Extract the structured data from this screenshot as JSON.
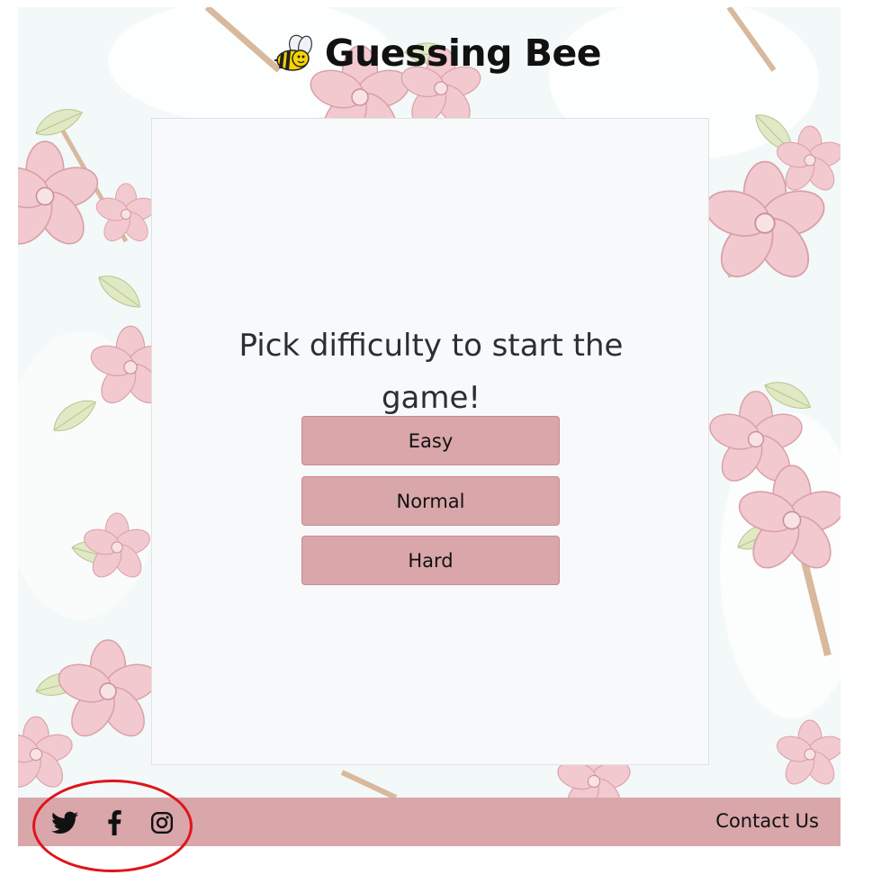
{
  "header": {
    "title": "Guessing Bee",
    "logo_icon": "bee-icon"
  },
  "game": {
    "prompt": "Pick difficulty to start the game!",
    "buttons": {
      "easy": "Easy",
      "normal": "Normal",
      "hard": "Hard"
    }
  },
  "footer": {
    "social_icons": [
      "twitter-icon",
      "facebook-icon",
      "instagram-icon"
    ],
    "contact_label": "Contact Us"
  },
  "colors": {
    "accent": "#d9a6aa",
    "card_background": "#f8f9fa",
    "annotation": "#e0131a"
  }
}
